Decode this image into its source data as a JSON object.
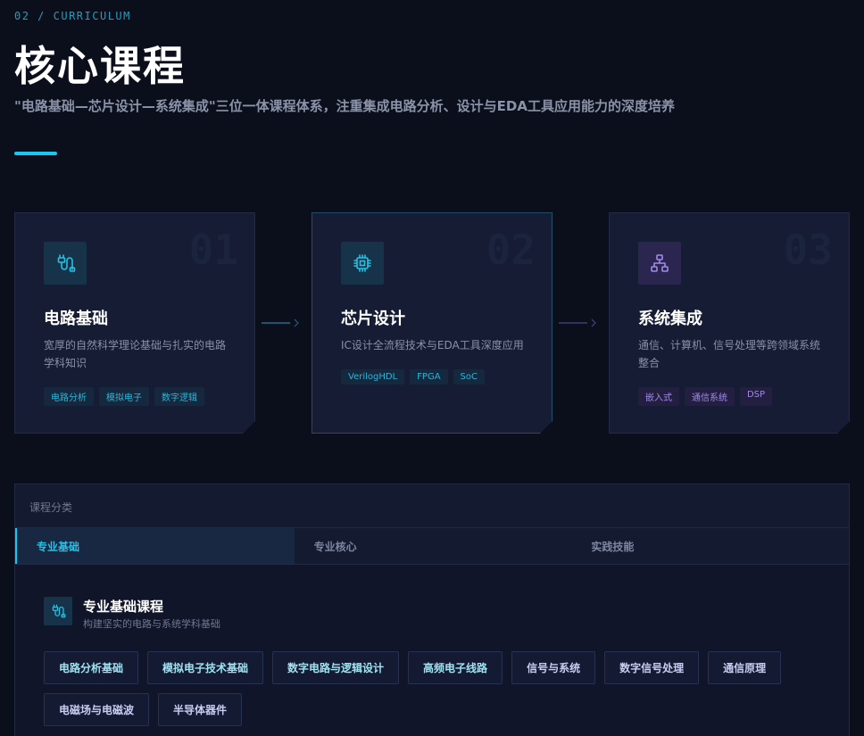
{
  "header": {
    "eyebrow": "02 / CURRICULUM",
    "title": "核心课程",
    "subtitle": "\"电路基础—芯片设计—系统集成\"三位一体课程体系，注重集成电路分析、设计与EDA工具应用能力的深度培养"
  },
  "pillars": [
    {
      "number": "01",
      "icon": "circuit-plug-icon",
      "title": "电路基础",
      "description": "宽厚的自然科学理论基础与扎实的电路学科知识",
      "tags": [
        "电路分析",
        "模拟电子",
        "数字逻辑"
      ]
    },
    {
      "number": "02",
      "icon": "chip-icon",
      "title": "芯片设计",
      "description": "IC设计全流程技术与EDA工具深度应用",
      "tags": [
        "VerilogHDL",
        "FPGA",
        "SoC"
      ]
    },
    {
      "number": "03",
      "icon": "network-icon",
      "title": "系统集成",
      "description": "通信、计算机、信号处理等跨领域系统整合",
      "tags": [
        "嵌入式",
        "通信系统",
        "DSP"
      ]
    }
  ],
  "panel": {
    "label": "课程分类",
    "tabs": [
      "专业基础",
      "专业核心",
      "实践技能"
    ],
    "active_tab": "专业基础",
    "content": {
      "icon": "circuit-plug-icon",
      "title": "专业基础课程",
      "subtitle": "构建坚实的电路与系统学科基础",
      "courses": [
        "电路分析基础",
        "模拟电子技术基础",
        "数字电路与逻辑设计",
        "高频电子线路",
        "信号与系统",
        "数字信号处理",
        "通信原理",
        "电磁场与电磁波",
        "半导体器件"
      ]
    }
  },
  "colors": {
    "accent": "#19c6ef",
    "purple": "#a28ae8",
    "background": "#0b0f1c"
  }
}
